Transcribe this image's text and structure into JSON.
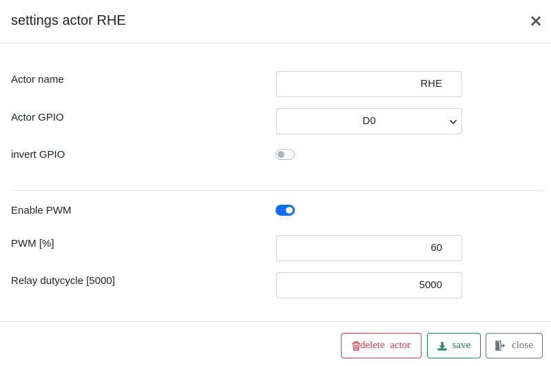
{
  "header": {
    "title": "settings actor RHE",
    "close_glyph": "×"
  },
  "fields": {
    "actor_name": {
      "label": "Actor name",
      "value": "RHE"
    },
    "actor_gpio": {
      "label": "Actor GPIO",
      "selected": "D0"
    },
    "invert_gpio": {
      "label": "invert GPIO",
      "checked": false
    },
    "enable_pwm": {
      "label": "Enable PWM",
      "checked": true
    },
    "pwm": {
      "label": "PWM [%]",
      "value": "60"
    },
    "relay_dutycycle": {
      "label": "Relay dutycycle [5000]",
      "value": "5000"
    }
  },
  "footer": {
    "delete_label": "delete  actor",
    "save_label": "save",
    "close_label": "close"
  },
  "icons": {
    "delete": "trash-icon",
    "save": "download-icon",
    "close": "door-exit-icon",
    "select": "chevron-down-icon"
  },
  "colors": {
    "accent": "#0d6efd",
    "danger": "#dc3545",
    "success": "#198754",
    "secondary": "#6c757d"
  }
}
